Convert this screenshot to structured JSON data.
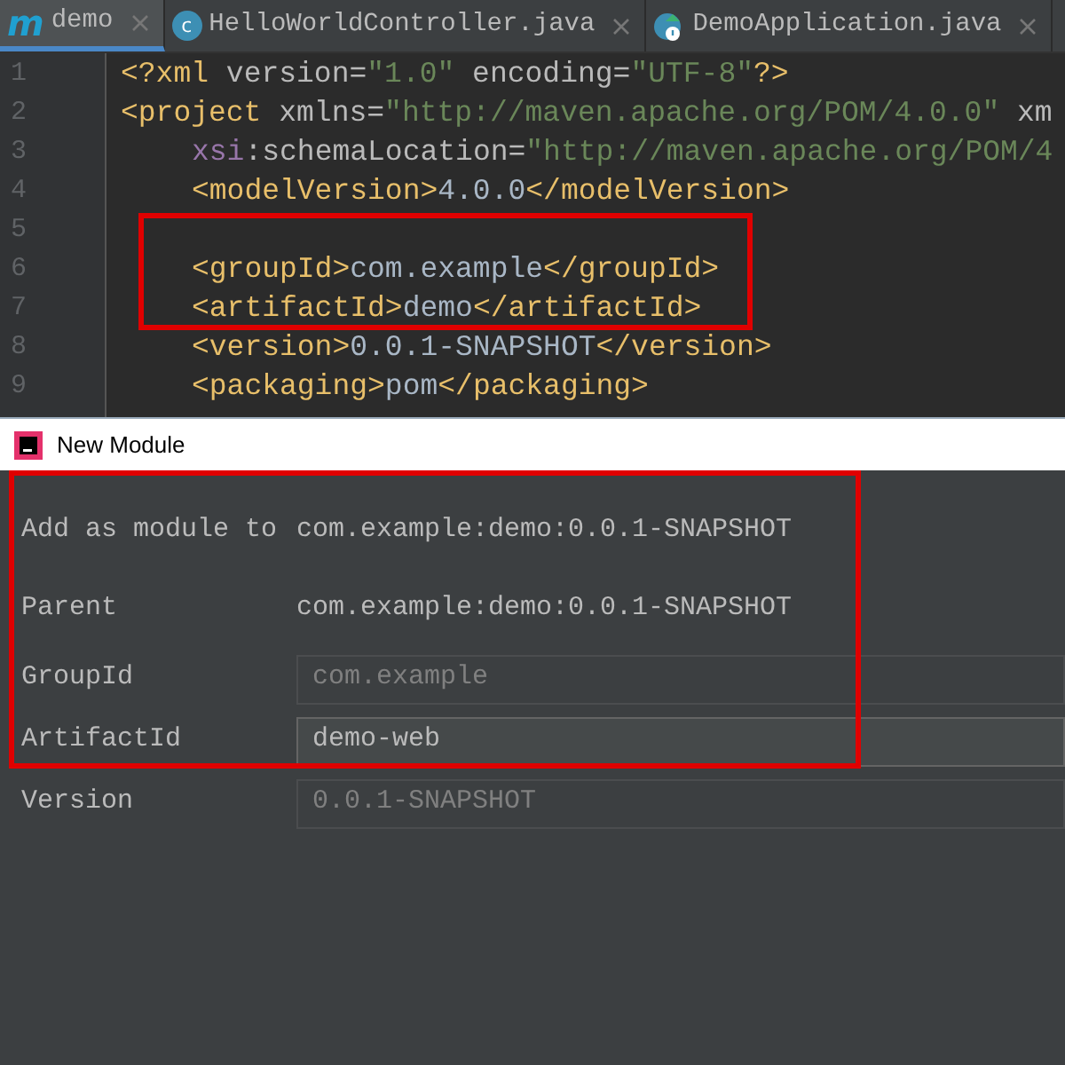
{
  "tabs": [
    {
      "label": "demo",
      "icon_text": "m",
      "selected": true
    },
    {
      "label": "HelloWorldController.java",
      "icon_text": "c",
      "selected": false
    },
    {
      "label": "DemoApplication.java",
      "selected": false
    }
  ],
  "editor": {
    "lines": [
      {
        "number": "1",
        "tokens": [
          {
            "kind": "tag",
            "text": "<?xml "
          },
          {
            "kind": "attr",
            "text": "version="
          },
          {
            "kind": "string",
            "text": "\"1.0\""
          },
          {
            "kind": "attr",
            "text": " encoding="
          },
          {
            "kind": "string",
            "text": "\"UTF-8\""
          },
          {
            "kind": "tag",
            "text": "?>"
          }
        ]
      },
      {
        "number": "2",
        "tokens": [
          {
            "kind": "tag",
            "text": "<project "
          },
          {
            "kind": "attr",
            "text": "xmlns="
          },
          {
            "kind": "string",
            "text": "\"http://maven.apache.org/POM/4.0.0\""
          },
          {
            "kind": "attr",
            "text": " xm"
          }
        ],
        "children": [
          {
            "number": "3",
            "tokens": [
              {
                "kind": "ns",
                "text": "xsi"
              },
              {
                "kind": "attr",
                "text": ":schemaLocation="
              },
              {
                "kind": "string",
                "text": "\"http://maven.apache.org/POM/4"
              }
            ]
          },
          {
            "number": "4",
            "tokens": [
              {
                "kind": "tag",
                "text": "<modelVersion>"
              },
              {
                "kind": "text",
                "text": "4.0.0"
              },
              {
                "kind": "tag",
                "text": "</modelVersion>"
              }
            ]
          },
          {
            "number": "5"
          },
          {
            "number": "6",
            "tokens": [
              {
                "kind": "tag",
                "text": "<groupId>"
              },
              {
                "kind": "text",
                "text": "com.example"
              },
              {
                "kind": "tag",
                "text": "</groupId>"
              }
            ]
          },
          {
            "number": "7",
            "tokens": [
              {
                "kind": "tag",
                "text": "<artifactId>"
              },
              {
                "kind": "text",
                "text": "demo"
              },
              {
                "kind": "tag",
                "text": "</artifactId>"
              }
            ]
          },
          {
            "number": "8",
            "tokens": [
              {
                "kind": "tag",
                "text": "<version>"
              },
              {
                "kind": "text",
                "text": "0.0.1-SNAPSHOT"
              },
              {
                "kind": "tag",
                "text": "</version>"
              }
            ]
          },
          {
            "number": "9",
            "tokens": [
              {
                "kind": "tag",
                "text": "<packaging>"
              },
              {
                "kind": "text",
                "text": "pom"
              },
              {
                "kind": "tag",
                "text": "</packaging>"
              }
            ]
          }
        ]
      }
    ]
  },
  "dialog": {
    "title": "New Module",
    "rows": [
      {
        "kind": "value",
        "label": "Add as module to",
        "value": "com.example:demo:0.0.1-SNAPSHOT"
      },
      {
        "kind": "value",
        "label": "Parent",
        "value": "com.example:demo:0.0.1-SNAPSHOT"
      },
      {
        "kind": "field",
        "label": "GroupId",
        "value": "com.example",
        "disabled": true
      },
      {
        "kind": "field",
        "label": "ArtifactId",
        "value": "demo-web",
        "disabled": false
      },
      {
        "kind": "field",
        "label": "Version",
        "value": "0.0.1-SNAPSHOT",
        "disabled": true
      }
    ]
  }
}
